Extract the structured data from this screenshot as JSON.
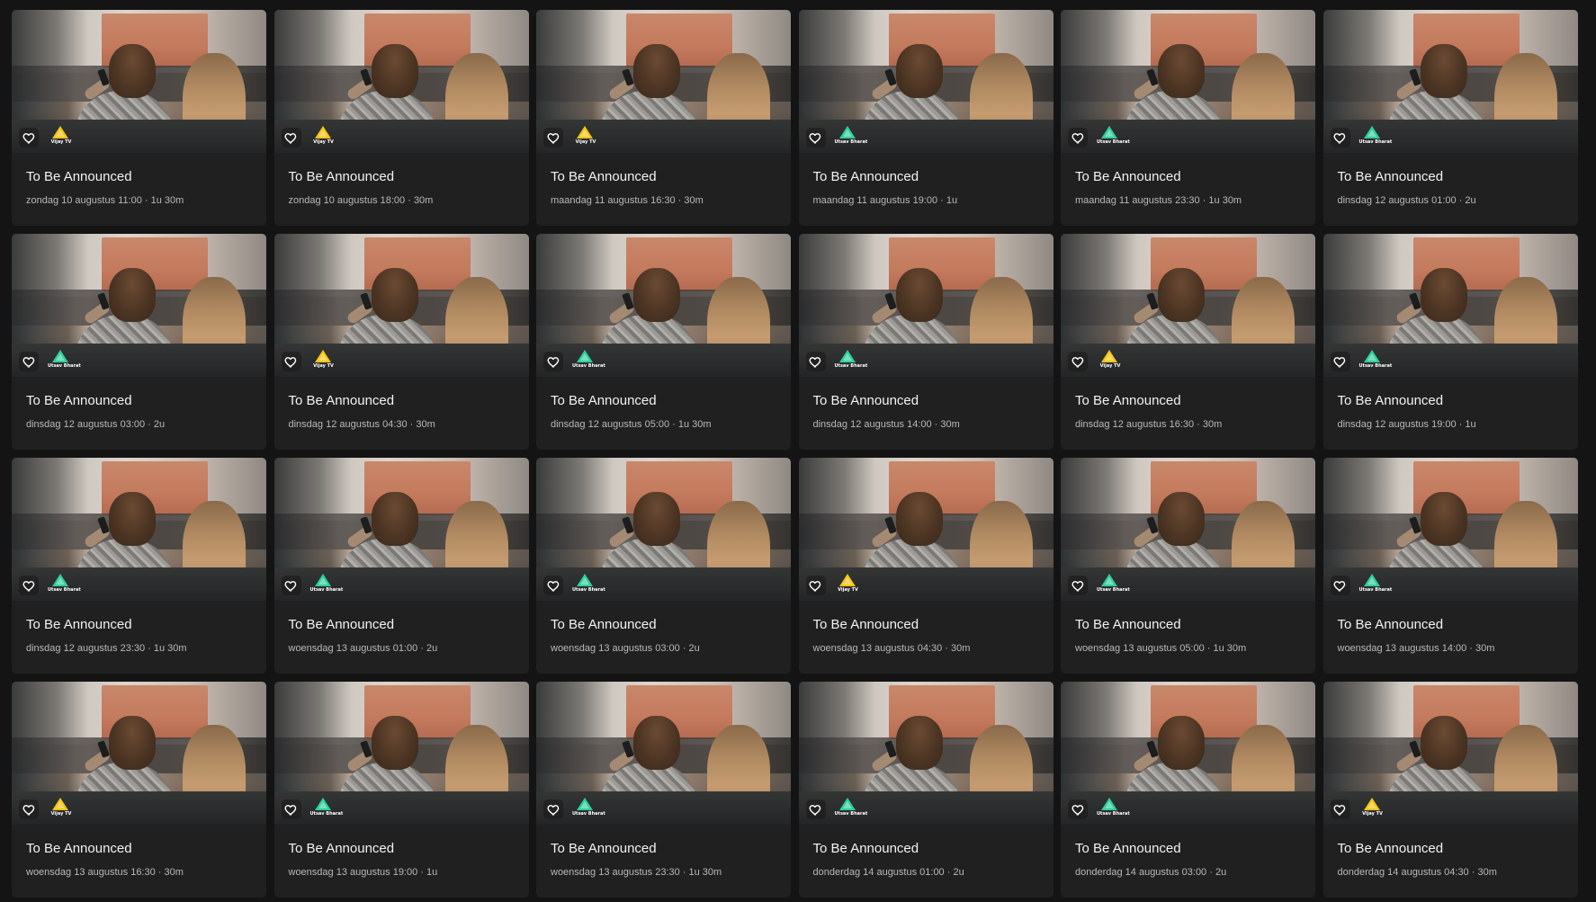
{
  "colors": {
    "background": "#141414",
    "card": "#202020",
    "title_text": "#f2f2f2",
    "meta_text": "#b9b9b9",
    "vijay_logo": "#f5c518",
    "utsav_logo": "#2ecf9a"
  },
  "icons": {
    "favorite": "heart-outline-icon"
  },
  "cards": [
    {
      "title": "To Be Announced",
      "meta": "zondag 10 augustus 11:00 · 1u 30m",
      "channel": "Vijay TV"
    },
    {
      "title": "To Be Announced",
      "meta": "zondag 10 augustus 18:00 · 30m",
      "channel": "Vijay TV"
    },
    {
      "title": "To Be Announced",
      "meta": "maandag 11 augustus 16:30 · 30m",
      "channel": "Vijay TV"
    },
    {
      "title": "To Be Announced",
      "meta": "maandag 11 augustus 19:00 · 1u",
      "channel": "Utsav Bharat"
    },
    {
      "title": "To Be Announced",
      "meta": "maandag 11 augustus 23:30 · 1u 30m",
      "channel": "Utsav Bharat"
    },
    {
      "title": "To Be Announced",
      "meta": "dinsdag 12 augustus 01:00 · 2u",
      "channel": "Utsav Bharat"
    },
    {
      "title": "To Be Announced",
      "meta": "dinsdag 12 augustus 03:00 · 2u",
      "channel": "Utsav Bharat"
    },
    {
      "title": "To Be Announced",
      "meta": "dinsdag 12 augustus 04:30 · 30m",
      "channel": "Vijay TV"
    },
    {
      "title": "To Be Announced",
      "meta": "dinsdag 12 augustus 05:00 · 1u 30m",
      "channel": "Utsav Bharat"
    },
    {
      "title": "To Be Announced",
      "meta": "dinsdag 12 augustus 14:00 · 30m",
      "channel": "Utsav Bharat"
    },
    {
      "title": "To Be Announced",
      "meta": "dinsdag 12 augustus 16:30 · 30m",
      "channel": "Vijay TV"
    },
    {
      "title": "To Be Announced",
      "meta": "dinsdag 12 augustus 19:00 · 1u",
      "channel": "Utsav Bharat"
    },
    {
      "title": "To Be Announced",
      "meta": "dinsdag 12 augustus 23:30 · 1u 30m",
      "channel": "Utsav Bharat"
    },
    {
      "title": "To Be Announced",
      "meta": "woensdag 13 augustus 01:00 · 2u",
      "channel": "Utsav Bharat"
    },
    {
      "title": "To Be Announced",
      "meta": "woensdag 13 augustus 03:00 · 2u",
      "channel": "Utsav Bharat"
    },
    {
      "title": "To Be Announced",
      "meta": "woensdag 13 augustus 04:30 · 30m",
      "channel": "Vijay TV"
    },
    {
      "title": "To Be Announced",
      "meta": "woensdag 13 augustus 05:00 · 1u 30m",
      "channel": "Utsav Bharat"
    },
    {
      "title": "To Be Announced",
      "meta": "woensdag 13 augustus 14:00 · 30m",
      "channel": "Utsav Bharat"
    },
    {
      "title": "To Be Announced",
      "meta": "woensdag 13 augustus 16:30 · 30m",
      "channel": "Vijay TV"
    },
    {
      "title": "To Be Announced",
      "meta": "woensdag 13 augustus 19:00 · 1u",
      "channel": "Utsav Bharat"
    },
    {
      "title": "To Be Announced",
      "meta": "woensdag 13 augustus 23:30 · 1u 30m",
      "channel": "Utsav Bharat"
    },
    {
      "title": "To Be Announced",
      "meta": "donderdag 14 augustus 01:00 · 2u",
      "channel": "Utsav Bharat"
    },
    {
      "title": "To Be Announced",
      "meta": "donderdag 14 augustus 03:00 · 2u",
      "channel": "Utsav Bharat"
    },
    {
      "title": "To Be Announced",
      "meta": "donderdag 14 augustus 04:30 · 30m",
      "channel": "Vijay TV"
    }
  ]
}
